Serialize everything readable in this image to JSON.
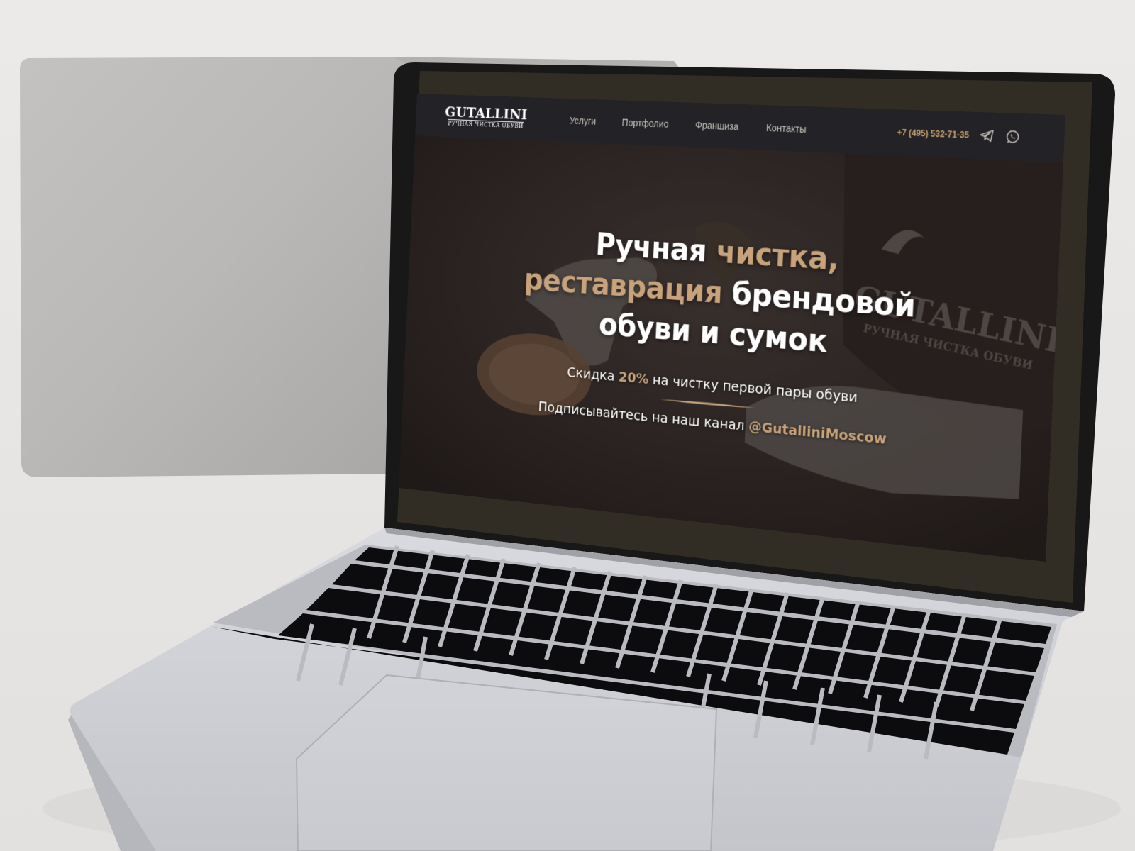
{
  "header": {
    "logo": {
      "name": "GUTALLINI",
      "tagline": "РУЧНАЯ ЧИСТКА ОБУВИ"
    },
    "nav": [
      {
        "label": "Услуги"
      },
      {
        "label": "Портфолио"
      },
      {
        "label": "Франшиза"
      },
      {
        "label": "Контакты"
      }
    ],
    "phone": "+7 (495) 532-71-35",
    "icons": [
      "telegram-icon",
      "whatsapp-icon"
    ]
  },
  "hero": {
    "title_part1": "Ручная ",
    "title_part2": "чистка,",
    "title_part3": "реставрация",
    "title_part4": " брендовой",
    "title_part5": "обуви и сумок",
    "promo_prefix": "Скидка ",
    "promo_highlight": "20%",
    "promo_suffix": " на чистку первой пары обуви",
    "subscribe_prefix": "Подписывайтесь на наш канал ",
    "subscribe_handle": "@GutalliniMoscow"
  },
  "photo_watermark": {
    "brand": "GUTALLINI",
    "tagline": "РУЧНАЯ ЧИСТКА ОБУВИ"
  },
  "colors": {
    "accent_gold": "#c7a27a",
    "phone_gold": "#c9a06e",
    "header_bg": "#232226",
    "page_bg": "#e8e7e6"
  }
}
